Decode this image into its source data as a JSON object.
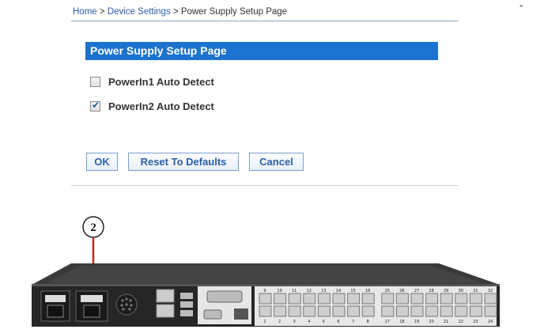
{
  "breadcrumb": {
    "home": "Home",
    "separator": " > ",
    "device_settings": "Device Settings",
    "current": "Power Supply Setup Page"
  },
  "corner_mark": "-",
  "panel": {
    "title": "Power Supply Setup Page",
    "options": [
      {
        "label": "PowerIn1 Auto Detect",
        "checked": false
      },
      {
        "label": "PowerIn2 Auto Detect",
        "checked": true
      }
    ]
  },
  "buttons": {
    "ok": "OK",
    "reset": "Reset To Defaults",
    "cancel": "Cancel"
  },
  "hardware": {
    "callout_number": "2",
    "port_labels_top": [
      "9",
      "10",
      "11",
      "12",
      "13",
      "14",
      "15",
      "16",
      "25",
      "26",
      "27",
      "28",
      "29",
      "30",
      "31",
      "32"
    ],
    "port_labels_bottom": [
      "1",
      "2",
      "3",
      "4",
      "5",
      "6",
      "7",
      "8",
      "17",
      "18",
      "19",
      "20",
      "21",
      "22",
      "23",
      "24"
    ],
    "colors": {
      "accent": "#1b73cf",
      "arrow": "#d42020",
      "chassis": "#2e2e2e"
    }
  }
}
